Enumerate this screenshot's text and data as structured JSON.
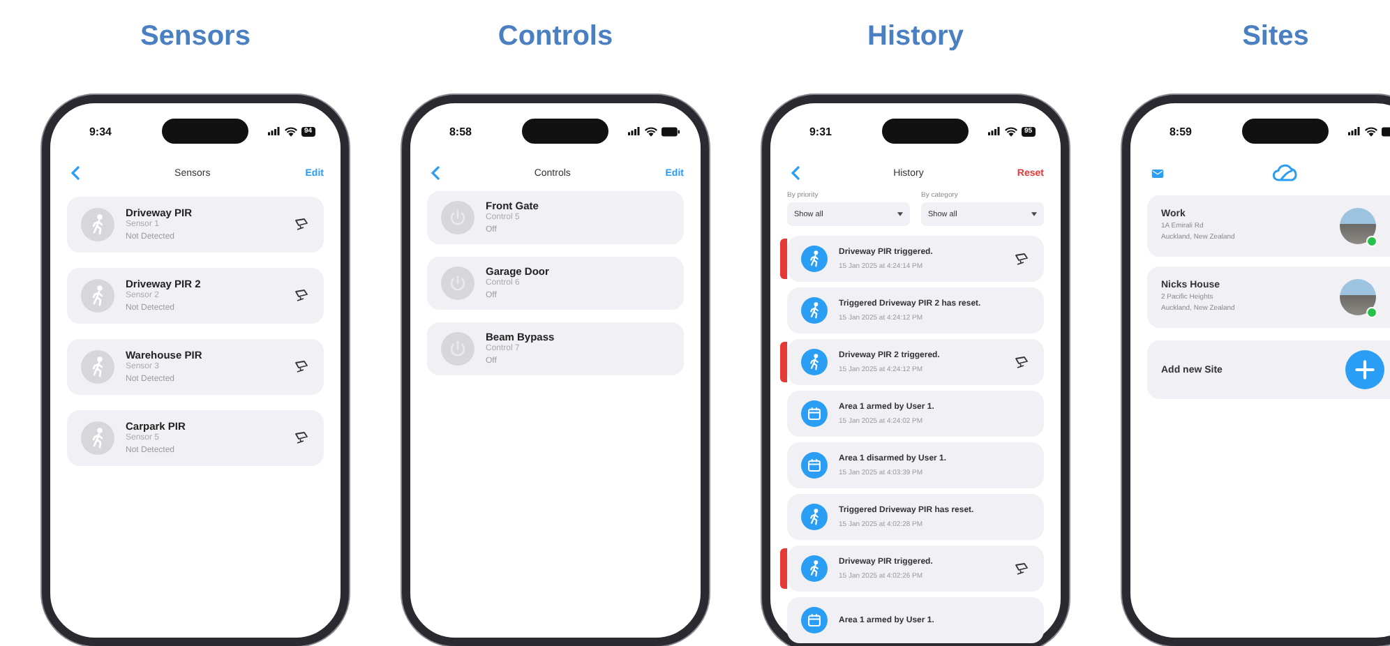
{
  "panels": [
    {
      "heading": "Sensors",
      "kind": "sensors",
      "time": "9:34",
      "battery": "94",
      "nav": {
        "title": "Sensors",
        "action": "Edit",
        "destructive": false
      },
      "items": [
        {
          "name": "Driveway PIR",
          "sub": "Sensor 1",
          "status": "Not Detected"
        },
        {
          "name": "Driveway PIR 2",
          "sub": "Sensor 2",
          "status": "Not Detected"
        },
        {
          "name": "Warehouse PIR",
          "sub": "Sensor 3",
          "status": "Not Detected"
        },
        {
          "name": "Carpark PIR",
          "sub": "Sensor 5",
          "status": "Not Detected"
        }
      ]
    },
    {
      "heading": "Controls",
      "kind": "controls",
      "time": "8:58",
      "nav": {
        "title": "Controls",
        "action": "Edit",
        "destructive": false
      },
      "items": [
        {
          "name": "Front Gate",
          "sub": "Control 5",
          "status": "Off"
        },
        {
          "name": "Garage Door",
          "sub": "Control 6",
          "status": "Off"
        },
        {
          "name": "Beam Bypass",
          "sub": "Control 7",
          "status": "Off"
        }
      ]
    },
    {
      "heading": "History",
      "kind": "history",
      "time": "9:31",
      "battery": "95",
      "nav": {
        "title": "History",
        "action": "Reset",
        "destructive": true
      },
      "filters": [
        {
          "label": "By priority",
          "value": "Show all"
        },
        {
          "label": "By category",
          "value": "Show all"
        }
      ],
      "events": [
        {
          "kind": "motion",
          "text": "Driveway PIR triggered.",
          "time": "15 Jan 2025 at 4:24:14 PM",
          "alarm": true
        },
        {
          "kind": "motion",
          "text": "Triggered Driveway PIR 2 has reset.",
          "time": "15 Jan 2025 at 4:24:12 PM",
          "alarm": false
        },
        {
          "kind": "motion",
          "text": "Driveway PIR 2 triggered.",
          "time": "15 Jan 2025 at 4:24:12 PM",
          "alarm": true
        },
        {
          "kind": "area",
          "text": "Area 1 armed by User 1.",
          "time": "15 Jan 2025 at 4:24:02 PM",
          "alarm": false
        },
        {
          "kind": "area",
          "text": "Area 1 disarmed by User 1.",
          "time": "15 Jan 2025 at 4:03:39 PM",
          "alarm": false
        },
        {
          "kind": "motion",
          "text": "Triggered Driveway PIR has reset.",
          "time": "15 Jan 2025 at 4:02:28 PM",
          "alarm": false
        },
        {
          "kind": "motion",
          "text": "Driveway PIR triggered.",
          "time": "15 Jan 2025 at 4:02:26 PM",
          "alarm": true
        },
        {
          "kind": "area",
          "text": "Area 1 armed by User 1.",
          "alarm": false
        }
      ]
    },
    {
      "heading": "Sites",
      "kind": "sites",
      "time": "8:59",
      "sites": [
        {
          "name": "Work",
          "address": "1A Emirali Rd",
          "region": "Auckland, New Zealand",
          "online": true
        },
        {
          "name": "Nicks House",
          "address": "2 Pacific Heights",
          "region": "Auckland, New Zealand",
          "online": true
        }
      ],
      "add_label": "Add new Site"
    }
  ]
}
